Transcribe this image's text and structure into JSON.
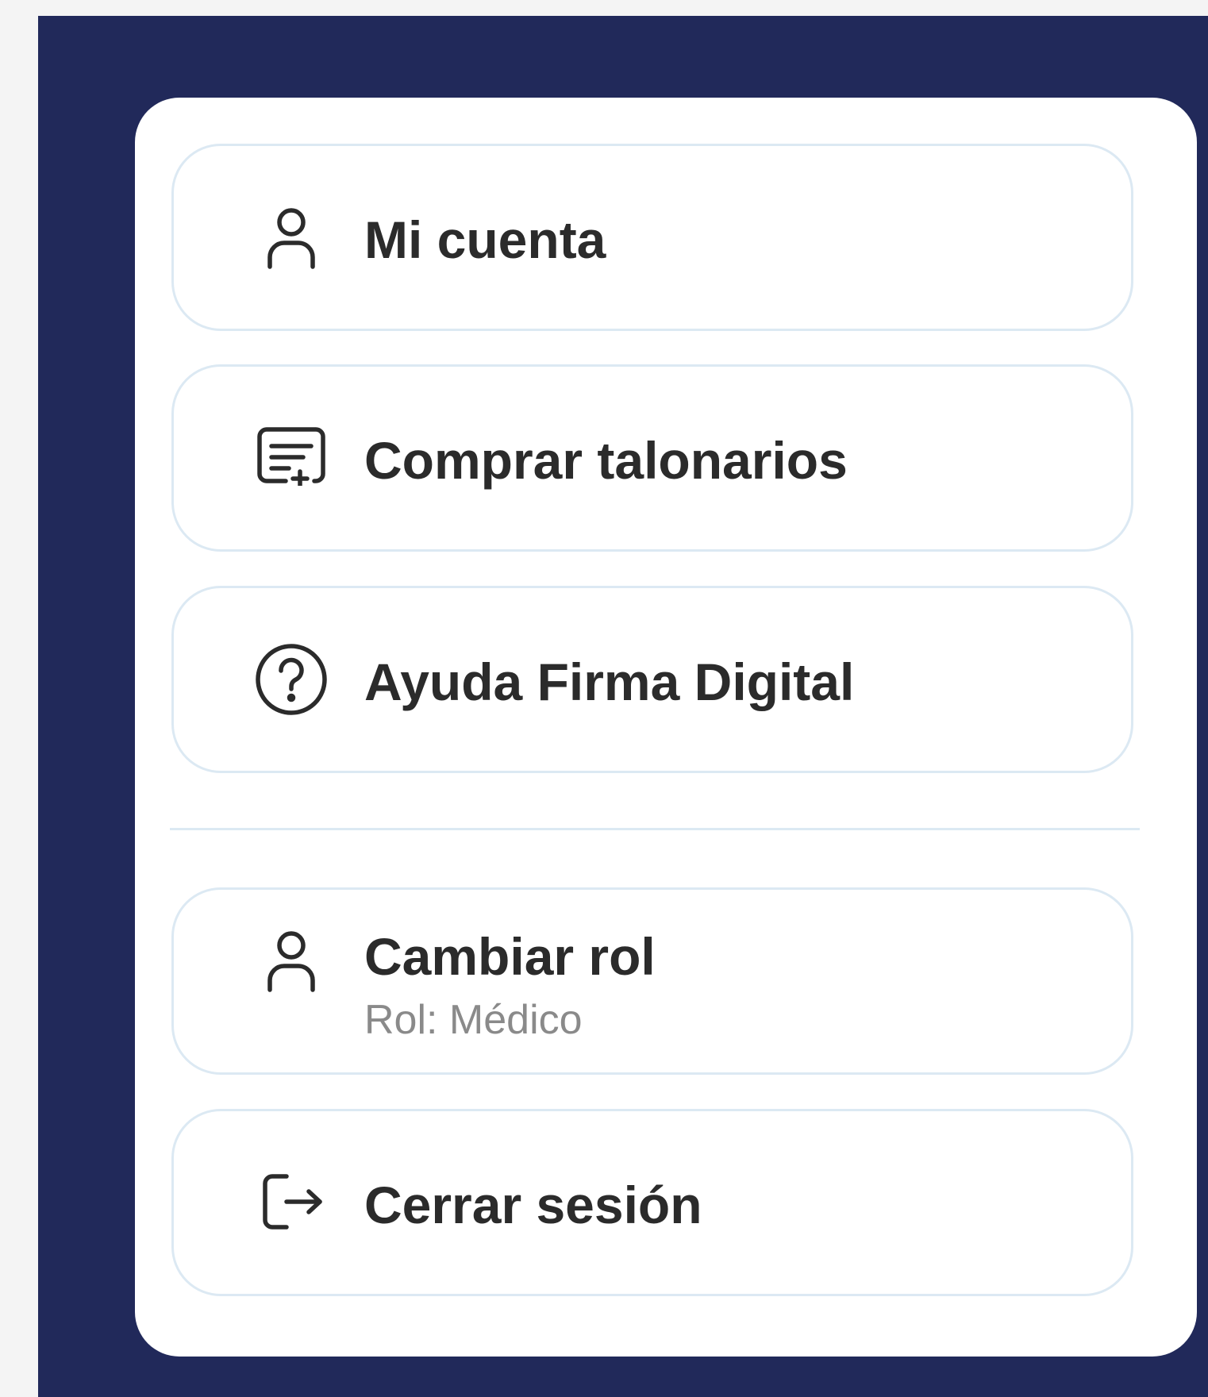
{
  "menu": {
    "items": [
      {
        "label": "Mi cuenta",
        "icon": "user-icon"
      },
      {
        "label": "Comprar talonarios",
        "icon": "receipt-add-icon"
      },
      {
        "label": "Ayuda Firma Digital",
        "icon": "help-circle-icon"
      }
    ],
    "role_item": {
      "label": "Cambiar rol",
      "sublabel": "Rol: Médico",
      "icon": "user-icon"
    },
    "logout": {
      "label": "Cerrar sesión",
      "icon": "logout-icon"
    }
  },
  "colors": {
    "background": "#21295a",
    "card": "#ffffff",
    "border": "#dce9f3",
    "text": "#2b2b2b",
    "subtext": "#8a8a8a"
  }
}
